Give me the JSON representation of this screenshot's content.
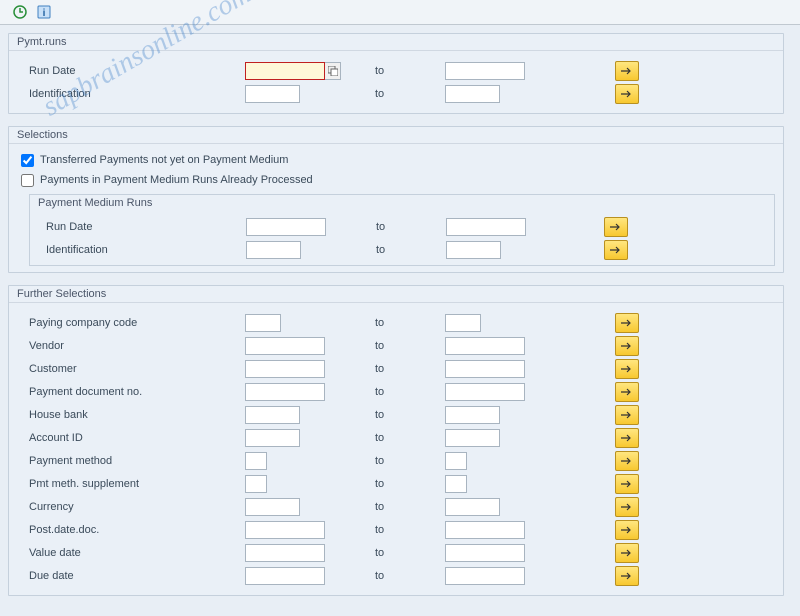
{
  "watermark": "sapbrainsonline.com",
  "to_label": "to",
  "groups": {
    "pymt_runs": {
      "title": "Pymt.runs",
      "run_date": "Run Date",
      "identification": "Identification"
    },
    "selections": {
      "title": "Selections",
      "chk_transferred": "Transferred Payments not yet on Payment Medium",
      "chk_processed": "Payments in Payment Medium Runs Already Processed",
      "subgroup_title": "Payment Medium Runs",
      "run_date": "Run Date",
      "identification": "Identification"
    },
    "further": {
      "title": "Further Selections",
      "rows": [
        "Paying company code",
        "Vendor",
        "Customer",
        "Payment document no.",
        "House bank",
        "Account ID",
        "Payment method",
        "Pmt meth. supplement",
        "Currency",
        "Post.date.doc.",
        "Value date",
        "Due date"
      ]
    }
  }
}
